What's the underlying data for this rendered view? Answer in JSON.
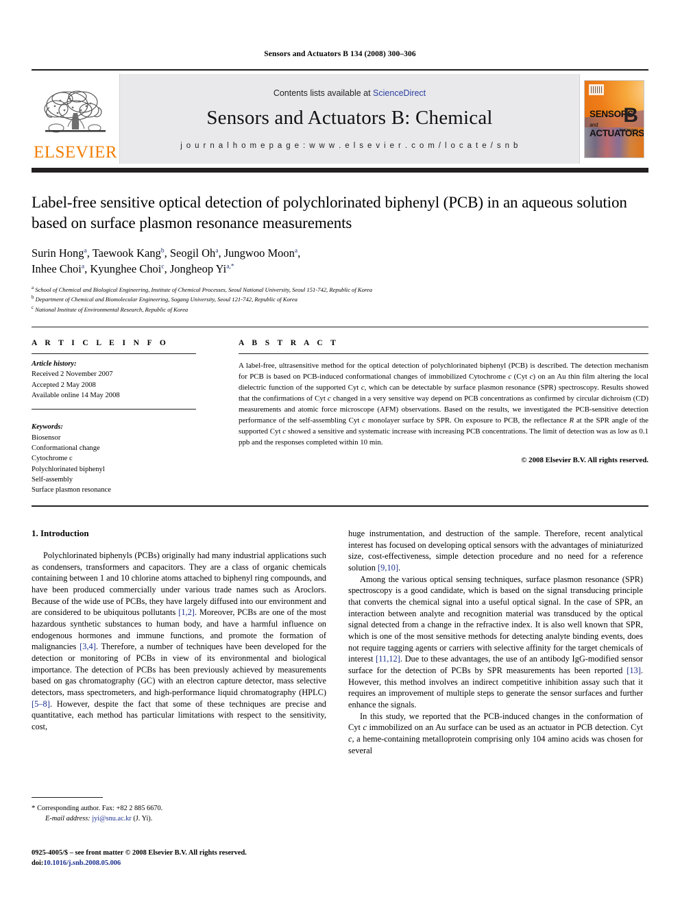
{
  "running_head": "Sensors and Actuators B 134 (2008) 300–306",
  "banner": {
    "publisher_wordmark": "ELSEVIER",
    "contents_prefix": "Contents lists available at ",
    "contents_link": "ScienceDirect",
    "journal_title": "Sensors and Actuators B: Chemical",
    "homepage": "j o u r n a l   h o m e p a g e :   w w w . e l s e v i e r . c o m / l o c a t e / s n b",
    "cover": {
      "line1": "SENSORS",
      "line1_small": "and",
      "line2": "ACTUATORS",
      "letter": "B",
      "sub": "CHEMICAL"
    },
    "link_color": "#2b3f9e",
    "brand_color": "#F07D00"
  },
  "article": {
    "title": "Label-free sensitive optical detection of polychlorinated biphenyl (PCB) in an aqueous solution based on surface plasmon resonance measurements",
    "authors_line1": "Surin Hong",
    "authors": [
      {
        "name": "Surin Hong",
        "sup": "a"
      },
      {
        "name": "Taewook Kang",
        "sup": "b"
      },
      {
        "name": "Seogil Oh",
        "sup": "a"
      },
      {
        "name": "Jungwoo Moon",
        "sup": "a"
      },
      {
        "name": "Inhee Choi",
        "sup": "a"
      },
      {
        "name": "Kyunghee Choi",
        "sup": "c"
      },
      {
        "name": "Jongheop Yi",
        "sup": "a,*"
      }
    ],
    "affiliations": [
      {
        "marker": "a",
        "text": "School of Chemical and Biological Engineering, Institute of Chemical Processes, Seoul National University, Seoul 151-742, Republic of Korea"
      },
      {
        "marker": "b",
        "text": "Department of Chemical and Biomolecular Engineering, Sogang University, Seoul 121-742, Republic of Korea"
      },
      {
        "marker": "c",
        "text": "National Institute of Environmental Research, Republic of Korea"
      }
    ]
  },
  "info": {
    "heading": "A R T I C L E   I N F O",
    "history_label": "Article history:",
    "history": [
      "Received 2 November 2007",
      "Accepted 2 May 2008",
      "Available online 14 May 2008"
    ],
    "keywords_label": "Keywords:",
    "keywords": [
      "Biosensor",
      "Conformational change",
      "Cytochrome c",
      "Polychlorinated biphenyl",
      "Self-assembly",
      "Surface plasmon resonance"
    ]
  },
  "abstract": {
    "heading": "A B S T R A C T",
    "text": "A label-free, ultrasensitive method for the optical detection of polychlorinated biphenyl (PCB) is described. The detection mechanism for PCB is based on PCB-induced conformational changes of immobilized Cytochrome c (Cyt c) on an Au thin film altering the local dielectric function of the supported Cyt c, which can be detectable by surface plasmon resonance (SPR) spectroscopy. Results showed that the confirmations of Cyt c changed in a very sensitive way depend on PCB concentrations as confirmed by circular dichroism (CD) measurements and atomic force microscope (AFM) observations. Based on the results, we investigated the PCB-sensitive detection performance of the self-assembling Cyt c monolayer surface by SPR. On exposure to PCB, the reflectance R at the SPR angle of the supported Cyt c showed a sensitive and systematic increase with increasing PCB concentrations. The limit of detection was as low as 0.1 ppb and the responses completed within 10 min.",
    "copyright": "© 2008 Elsevier B.V. All rights reserved."
  },
  "body": {
    "section_number_title": "1.  Introduction",
    "left_para_1": "Polychlorinated biphenyls (PCBs) originally had many industrial applications such as condensers, transformers and capacitors. They are a class of organic chemicals containing between 1 and 10 chlorine atoms attached to biphenyl ring compounds, and have been produced commercially under various trade names such as Aroclors. Because of the wide use of PCBs, they have largely diffused into our environment and are considered to be ubiquitous pollutants [1,2]. Moreover, PCBs are one of the most hazardous synthetic substances to human body, and have a harmful influence on endogenous hormones and immune functions, and promote the formation of malignancies [3,4]. Therefore, a number of techniques have been developed for the detection or monitoring of PCBs in view of its environmental and biological importance. The detection of PCBs has been previously achieved by measurements based on gas chromatography (GC) with an electron capture detector, mass selective detectors, mass spectrometers, and high-performance liquid chromatography (HPLC) [5–8]. However, despite the fact that some of these techniques are precise and quantitative, each method has particular limitations with respect to the sensitivity, cost,",
    "right_para_1": "huge instrumentation, and destruction of the sample. Therefore, recent analytical interest has focused on developing optical sensors with the advantages of miniaturized size, cost-effectiveness, simple detection procedure and no need for a reference solution [9,10].",
    "right_para_2": "Among the various optical sensing techniques, surface plasmon resonance (SPR) spectroscopy is a good candidate, which is based on the signal transducing principle that converts the chemical signal into a useful optical signal. In the case of SPR, an interaction between analyte and recognition material was transduced by the optical signal detected from a change in the refractive index. It is also well known that SPR, which is one of the most sensitive methods for detecting analyte binding events, does not require tagging agents or carriers with selective affinity for the target chemicals of interest [11,12]. Due to these advantages, the use of an antibody IgG-modified sensor surface for the detection of PCBs by SPR measurements has been reported [13]. However, this method involves an indirect competitive inhibition assay such that it requires an improvement of multiple steps to generate the sensor surfaces and further enhance the signals.",
    "right_para_3": "In this study, we reported that the PCB-induced changes in the conformation of Cyt c immobilized on an Au surface can be used as an actuator in PCB detection. Cyt c, a heme-containing metalloprotein comprising only 104 amino acids was chosen for several"
  },
  "footnote": {
    "star": "*",
    "corresponding": "Corresponding author. Fax: +82 2 885 6670.",
    "email_label": "E-mail address:",
    "email": "jyi@snu.ac.kr",
    "email_suffix": "(J. Yi)."
  },
  "imprint": {
    "line1": "0925-4005/$ – see front matter © 2008 Elsevier B.V. All rights reserved.",
    "doi_label": "doi:",
    "doi_value": "10.1016/j.snb.2008.05.006"
  }
}
